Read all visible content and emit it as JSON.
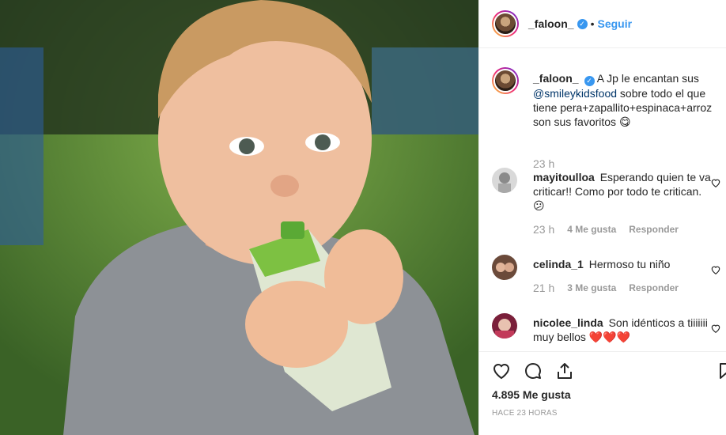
{
  "post": {
    "author": "_faloon_",
    "follow_label": "Seguir",
    "separator": "•"
  },
  "caption": {
    "username": "_faloon_",
    "text_before": "A Jp le encantan sus ",
    "mention": "@smileykidsfood",
    "text_after": " sobre todo el que tiene pera+zapallito+espinaca+arroz son sus favoritos 😋",
    "time": "23 h"
  },
  "comments": [
    {
      "username": "mayitoulloa",
      "text": "Esperando quien te va criticar!! Como por todo te critican. 😕",
      "time": "23 h",
      "likes": "4 Me gusta",
      "reply": "Responder"
    },
    {
      "username": "celinda_1",
      "text": "Hermoso tu niño",
      "time": "21 h",
      "likes": "3 Me gusta",
      "reply": "Responder"
    },
    {
      "username": "nicolee_linda",
      "text": "Son idénticos a tiiiiiii muy bellos ❤️❤️❤️",
      "time": "",
      "likes": "",
      "reply": ""
    }
  ],
  "footer": {
    "likes": "4.895 Me gusta",
    "ago": "HACE 23 HORAS"
  },
  "colors": {
    "accent": "#3897f0",
    "meta": "#999999"
  },
  "icons": [
    "heart-icon",
    "comment-icon",
    "share-icon",
    "bookmark-icon",
    "verified-badge-icon"
  ]
}
